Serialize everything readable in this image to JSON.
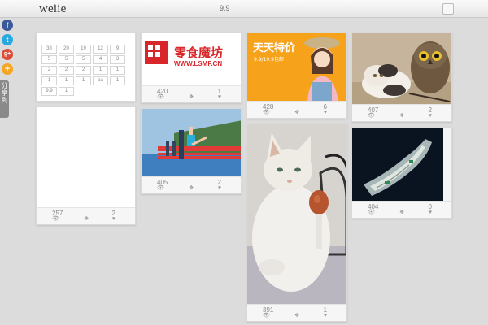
{
  "header": {
    "logo": "weiie",
    "center_text": "9.9"
  },
  "share": {
    "label": "分享到",
    "icons": [
      {
        "name": "facebook",
        "glyph": "f",
        "color": "#3b5998"
      },
      {
        "name": "twitter",
        "glyph": "t",
        "color": "#29a9e0"
      },
      {
        "name": "google-plus",
        "glyph": "g+",
        "color": "#dd4b39"
      },
      {
        "name": "add",
        "glyph": "+",
        "color": "#f5a623"
      }
    ]
  },
  "table_card": {
    "rows": [
      [
        "38",
        "20",
        "19",
        "12",
        "9"
      ],
      [
        "5",
        "5",
        "5",
        "4",
        "3"
      ],
      [
        "2",
        "2",
        "2",
        "1",
        "1"
      ],
      [
        "1",
        "1",
        "1",
        "pa",
        "1"
      ],
      [
        "9.9",
        "1"
      ]
    ]
  },
  "cards": [
    {
      "id": "blank",
      "views": "257",
      "likes": "2"
    },
    {
      "id": "lsmf",
      "brand_cn": "零食魔坊",
      "brand_url": "WWW.LSMF.CN",
      "views": "420",
      "likes": "1"
    },
    {
      "id": "railing",
      "views": "405",
      "likes": "2"
    },
    {
      "id": "promo",
      "promo_title": "天天特价",
      "promo_sub": "9.9/19.9包邮",
      "views": "428",
      "likes": "6"
    },
    {
      "id": "egg-cat",
      "views": "391",
      "likes": "1"
    },
    {
      "id": "owl-cat",
      "views": "407",
      "likes": "2"
    },
    {
      "id": "island",
      "views": "404",
      "likes": "0"
    }
  ],
  "icons": {
    "view": "eye-icon",
    "comment": "comment-icon",
    "like": "heart-icon"
  }
}
